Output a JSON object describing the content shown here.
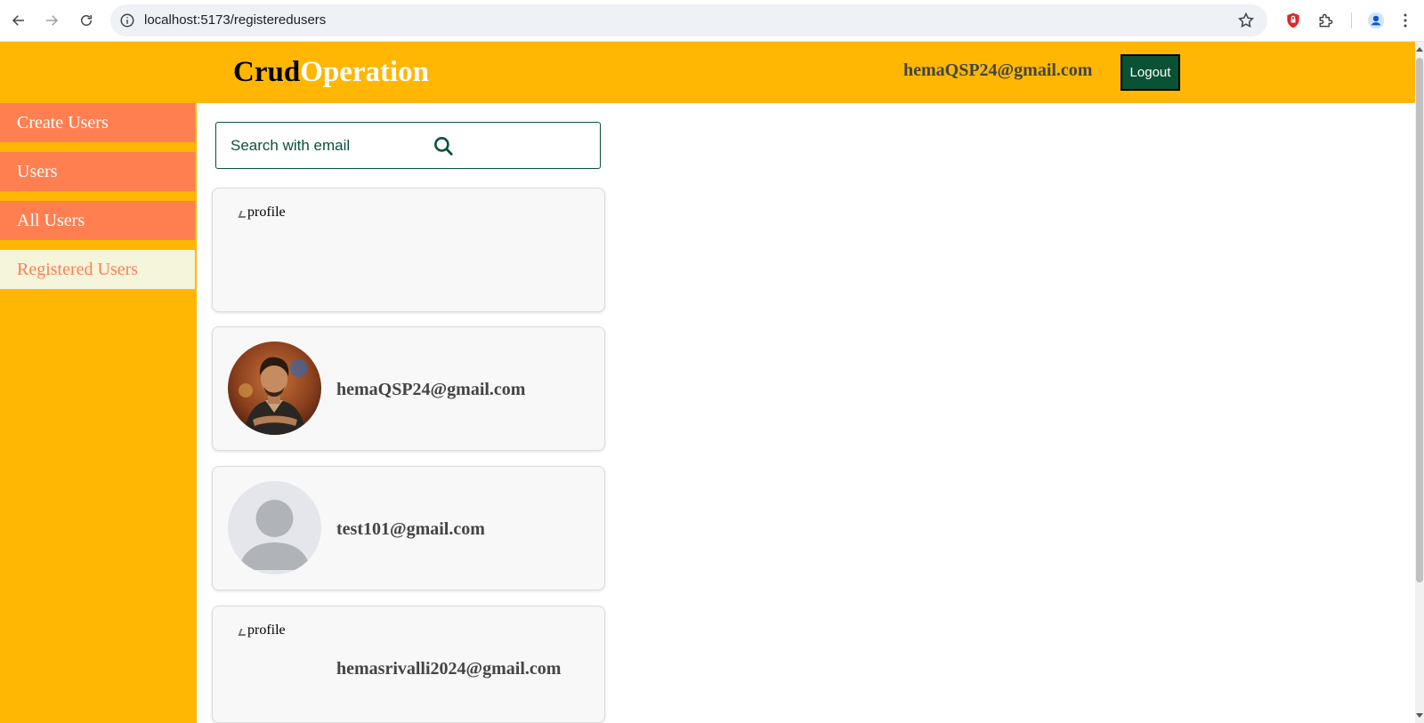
{
  "browser": {
    "url": "localhost:5173/registeredusers",
    "icons": [
      "back-arrow-icon",
      "forward-arrow-icon",
      "reload-icon",
      "site-info-icon",
      "bookmark-star-icon",
      "shield-extension-icon",
      "extensions-puzzle-icon",
      "profile-icon",
      "menu-kebab-icon"
    ]
  },
  "header": {
    "brand_part1": "Crud",
    "brand_part2": "Operation",
    "user_email": "hemaQSP24@gmail.com",
    "logout_label": "Logout",
    "colors": {
      "background": "#ffb703",
      "logout_button": "#0a5236"
    }
  },
  "sidebar": {
    "items": [
      {
        "label": "Create Users",
        "active": false
      },
      {
        "label": "Users",
        "active": false
      },
      {
        "label": "All Users",
        "active": false
      },
      {
        "label": "Registered Users",
        "active": true
      }
    ],
    "colors": {
      "item": "#ff7f50",
      "active_item": "#f5f5dc"
    }
  },
  "search": {
    "placeholder": "Search with email",
    "icon": "search-icon"
  },
  "users": [
    {
      "email": "",
      "image_alt": "profile",
      "image": "broken"
    },
    {
      "email": "hemaQSP24@gmail.com",
      "image_alt": "profile",
      "image": "photo"
    },
    {
      "email": "test101@gmail.com",
      "image_alt": "profile",
      "image": "default-avatar"
    },
    {
      "email": "hemasrivalli2024@gmail.com",
      "image_alt": "profile",
      "image": "broken"
    }
  ]
}
